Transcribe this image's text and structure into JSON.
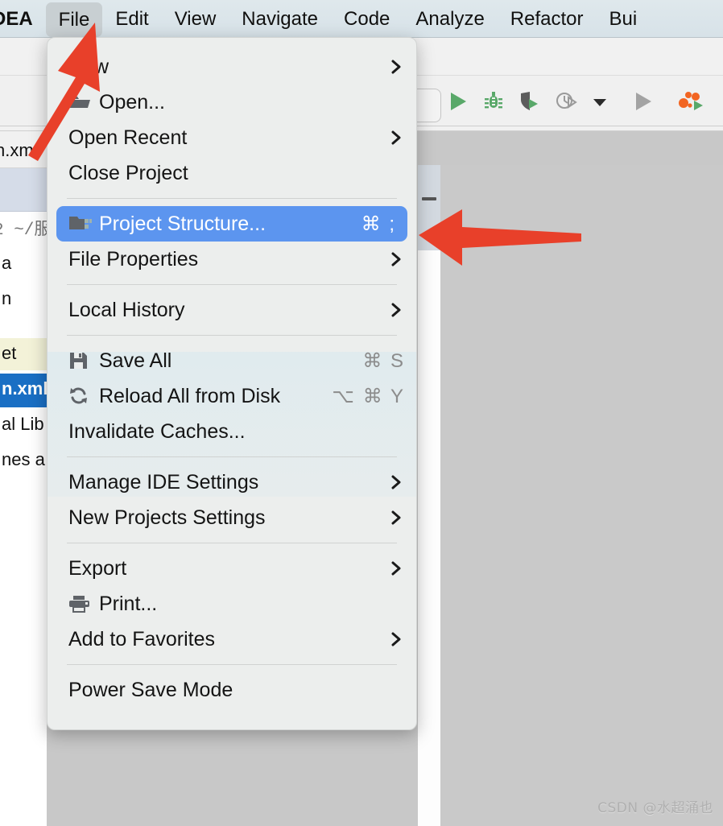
{
  "app": {
    "name": "IntelliJ IDEA",
    "menubar_app_label": "DEA"
  },
  "menubar": {
    "items": [
      {
        "label": "File",
        "active": true
      },
      {
        "label": "Edit",
        "active": false
      },
      {
        "label": "View",
        "active": false
      },
      {
        "label": "Navigate",
        "active": false
      },
      {
        "label": "Code",
        "active": false
      },
      {
        "label": "Analyze",
        "active": false
      },
      {
        "label": "Refactor",
        "active": false
      },
      {
        "label": "Bui",
        "active": false
      }
    ]
  },
  "toolbar": {
    "icons": [
      {
        "name": "run-icon",
        "glyph": "▶"
      },
      {
        "name": "debug-icon",
        "glyph": "bug"
      },
      {
        "name": "run-with-coverage-icon",
        "glyph": "shield-run"
      },
      {
        "name": "profile-icon",
        "glyph": "clock-run"
      },
      {
        "name": "dropdown-chevron-icon",
        "glyph": "▾"
      },
      {
        "name": "run-gray-icon",
        "glyph": "▶"
      },
      {
        "name": "run-dashboard-icon",
        "glyph": "services-run"
      }
    ]
  },
  "left_panel": {
    "tab_label": "n.xm",
    "path_label": "2  ~/服",
    "rows": [
      {
        "text": "a",
        "highlight": "none"
      },
      {
        "text": "n",
        "highlight": "none"
      },
      {
        "text": "et",
        "highlight": "yellow"
      },
      {
        "text": "n.xml",
        "highlight": "blue"
      },
      {
        "text": "al Lib",
        "highlight": "none"
      },
      {
        "text": "nes a",
        "highlight": "none"
      }
    ]
  },
  "file_menu": {
    "title": "File",
    "groups": [
      {
        "items": [
          {
            "label": "New",
            "icon": null,
            "accel": null,
            "submenu": true,
            "selected": false
          },
          {
            "label": "Open...",
            "icon": "folder-open-icon",
            "accel": null,
            "submenu": false,
            "selected": false
          },
          {
            "label": "Open Recent",
            "icon": null,
            "accel": null,
            "submenu": true,
            "selected": false
          },
          {
            "label": "Close Project",
            "icon": null,
            "accel": null,
            "submenu": false,
            "selected": false
          }
        ]
      },
      {
        "items": [
          {
            "label": "Project Structure...",
            "icon": "project-structure-icon",
            "accel": "⌘ ;",
            "submenu": false,
            "selected": true
          },
          {
            "label": "File Properties",
            "icon": null,
            "accel": null,
            "submenu": true,
            "selected": false
          }
        ]
      },
      {
        "items": [
          {
            "label": "Local History",
            "icon": null,
            "accel": null,
            "submenu": true,
            "selected": false
          }
        ]
      },
      {
        "items": [
          {
            "label": "Save All",
            "icon": "save-icon",
            "accel": "⌘ S",
            "submenu": false,
            "selected": false
          },
          {
            "label": "Reload All from Disk",
            "icon": "reload-icon",
            "accel": "⌥ ⌘ Y",
            "submenu": false,
            "selected": false
          },
          {
            "label": "Invalidate Caches...",
            "icon": null,
            "accel": null,
            "submenu": false,
            "selected": false
          }
        ]
      },
      {
        "items": [
          {
            "label": "Manage IDE Settings",
            "icon": null,
            "accel": null,
            "submenu": true,
            "selected": false
          },
          {
            "label": "New Projects Settings",
            "icon": null,
            "accel": null,
            "submenu": true,
            "selected": false
          }
        ]
      },
      {
        "items": [
          {
            "label": "Export",
            "icon": null,
            "accel": null,
            "submenu": true,
            "selected": false
          },
          {
            "label": "Print...",
            "icon": "print-icon",
            "accel": null,
            "submenu": false,
            "selected": false
          },
          {
            "label": "Add to Favorites",
            "icon": null,
            "accel": null,
            "submenu": true,
            "selected": false
          }
        ]
      },
      {
        "items": [
          {
            "label": "Power Save Mode",
            "icon": null,
            "accel": null,
            "submenu": false,
            "selected": false
          }
        ]
      }
    ]
  },
  "annotations": {
    "arrow_color": "#e8402a",
    "arrows": [
      {
        "name": "arrow-pointing-to-file-menu",
        "target": "File"
      },
      {
        "name": "arrow-pointing-to-project-structure",
        "target": "Project Structure..."
      }
    ]
  },
  "watermark": {
    "text": "CSDN @水超涌也"
  },
  "colors": {
    "menubar_bg": "#dae4e9",
    "menu_bg": "#eceeed",
    "selection_blue": "#5c95ef",
    "accent_red": "#e8402a",
    "content_grey": "#c9c9c9",
    "tree_selection_blue": "#1a6fc4",
    "tree_highlight_yellow": "#f3f2d8"
  }
}
